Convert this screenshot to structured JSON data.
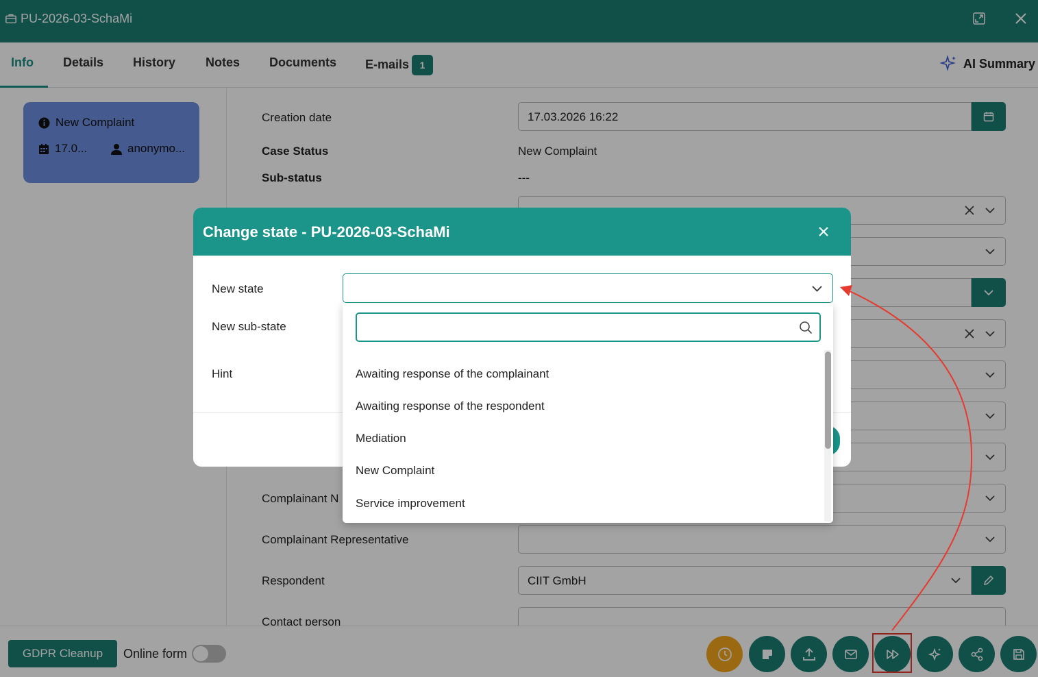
{
  "window": {
    "title": "PU-2026-03-SchaMi"
  },
  "tabs": [
    {
      "label": "Info"
    },
    {
      "label": "Details"
    },
    {
      "label": "History"
    },
    {
      "label": "Notes"
    },
    {
      "label": "Documents"
    },
    {
      "label": "E-mails",
      "badge": "1"
    }
  ],
  "ai_summary": {
    "label": "AI Summary"
  },
  "state_card": {
    "state": "New Complaint",
    "date": "17.0...",
    "user": "anonymo..."
  },
  "form": {
    "creation_date": {
      "label": "Creation date",
      "value": "17.03.2026 16:22"
    },
    "case_status": {
      "label": "Case Status",
      "value": "New Complaint"
    },
    "sub_status": {
      "label": "Sub-status",
      "value": "---"
    },
    "complainant_n": {
      "label": "Complainant N"
    },
    "complainant_rep": {
      "label": "Complainant Representative"
    },
    "respondent": {
      "label": "Respondent",
      "value": "CIIT GmbH"
    },
    "contact_person": {
      "label": "Contact person"
    }
  },
  "dialog": {
    "title": "Change state - PU-2026-03-SchaMi",
    "new_state_label": "New state",
    "new_substate_label": "New sub-state",
    "hint_label": "Hint",
    "options": [
      "Awaiting response of the complainant",
      "Awaiting response of the respondent",
      "Mediation",
      "New Complaint",
      "Service improvement"
    ]
  },
  "bottom": {
    "gdpr_label": "GDPR Cleanup",
    "online_form_label": "Online form"
  },
  "colors": {
    "primary": "#1b7d73",
    "dialog_header": "#1b958a",
    "card": "#6c8fe0",
    "highlight": "#e53a2f",
    "orange": "#f2a51c"
  }
}
